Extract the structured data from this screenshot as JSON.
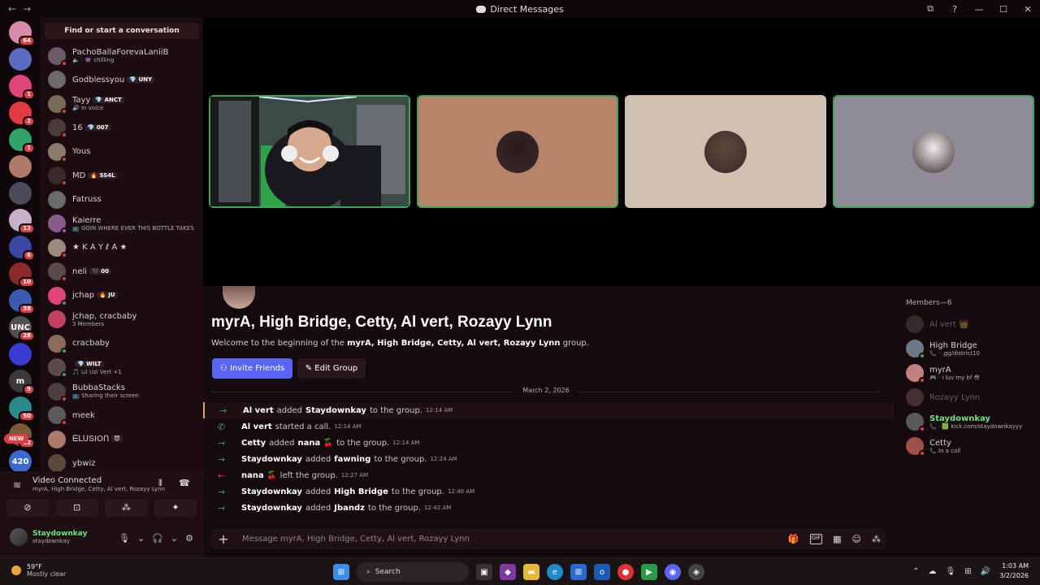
{
  "window": {
    "title": "Direct Messages",
    "back": "←",
    "forward": "→",
    "controls": [
      "⧉",
      "?",
      "—",
      "☐",
      "✕"
    ]
  },
  "guilds": [
    {
      "color": "#d98aa8",
      "badge": "64",
      "label": ""
    },
    {
      "color": "#5b6bc0",
      "badge": "",
      "label": ""
    },
    {
      "color": "#e0457a",
      "badge": "1",
      "label": ""
    },
    {
      "color": "#e23c43",
      "badge": "2",
      "label": ""
    },
    {
      "color": "#2fa36a",
      "badge": "1",
      "label": ""
    },
    {
      "color": "#b07a6a",
      "badge": "",
      "label": ""
    },
    {
      "color": "#4a4a5a",
      "badge": "",
      "label": ""
    },
    {
      "color": "#c8b0c8",
      "badge": "12",
      "label": ""
    },
    {
      "color": "#3b47a0",
      "badge": "6",
      "label": ""
    },
    {
      "color": "#8a2a2a",
      "badge": "10",
      "label": ""
    },
    {
      "color": "#3a5ab0",
      "badge": "38",
      "label": ""
    },
    {
      "color": "#505050",
      "badge": "28",
      "label": "UNC"
    },
    {
      "color": "#3a3ad0",
      "badge": "",
      "label": ""
    },
    {
      "color": "#3a3a3a",
      "badge": "9",
      "label": "m"
    },
    {
      "color": "#2a8a8a",
      "badge": "50",
      "label": ""
    },
    {
      "color": "#7a5a3a",
      "badge": "12",
      "label": ""
    },
    {
      "color": "#3a6ad0",
      "badge": "",
      "label": "420"
    }
  ],
  "guilds_new": "NEW",
  "dm": {
    "search_placeholder": "Find or start a conversation",
    "items": [
      {
        "name": "PachoBallaForevaLaniiB",
        "tag": "",
        "sub": "🔈 · 👾 chilling",
        "avatar": "#6a5a6a",
        "status": "#e23c43"
      },
      {
        "name": "Godblessyou",
        "tag": "💎 UNY",
        "sub": "",
        "avatar": "#6a6a6a",
        "status": ""
      },
      {
        "name": "Tayy",
        "tag": "💎 ANCT",
        "sub": "🔊 In voice",
        "avatar": "#7a6a5a",
        "status": "#e23c43"
      },
      {
        "name": "16",
        "tag": "💎 007",
        "sub": "",
        "avatar": "#4a3a3a",
        "status": "#e23c43"
      },
      {
        "name": "Yous",
        "tag": "",
        "sub": "",
        "avatar": "#8a7a6a",
        "status": "#e23c43"
      },
      {
        "name": "MD",
        "tag": "🔥 SS4L",
        "sub": "",
        "avatar": "#3a2a2a",
        "status": "#e23c43"
      },
      {
        "name": "Fatruss",
        "tag": "",
        "sub": "",
        "avatar": "#6a6a6a",
        "status": ""
      },
      {
        "name": "Kaierre",
        "tag": "",
        "sub": "📺 GOIN WHERE EVER THIS BOTTLE TAKES",
        "avatar": "#8a5a8a",
        "status": "#9b59d0"
      },
      {
        "name": "★ K A Y ℓ A ★",
        "tag": "",
        "sub": "",
        "avatar": "#9a8a7a",
        "status": "#e23c43"
      },
      {
        "name": "neli",
        "tag": "🖤 00",
        "sub": "",
        "avatar": "#5a4a4a",
        "status": "#e23c43"
      },
      {
        "name": "jchap",
        "tag": "🔥 JU",
        "sub": "",
        "avatar": "#e0457a",
        "status": "#3ba55c"
      },
      {
        "name": "jchap, cracbaby",
        "tag": "",
        "sub": "3 Members",
        "avatar": "#c04060",
        "status": ""
      },
      {
        "name": "cracbaby",
        "tag": "",
        "sub": "",
        "avatar": "#8a6a5a",
        "status": "#3ba55c"
      },
      {
        "name": "",
        "tag": "💎 WILT",
        "sub": "🎵 Lil Uzi Vert +1",
        "avatar": "#5a4a4a",
        "status": "#3ba55c"
      },
      {
        "name": "BubbaStacks",
        "tag": "",
        "sub": "📺 Sharing their screen",
        "avatar": "#4a4040",
        "status": "#e23c43"
      },
      {
        "name": "meek",
        "tag": "",
        "sub": "",
        "avatar": "#5a5a5a",
        "status": "#e23c43"
      },
      {
        "name": "ᗴᒪᑌՏIOᑎ",
        "tag": "😈",
        "sub": "",
        "avatar": "#b07a6a",
        "status": ""
      },
      {
        "name": "ybwiz",
        "tag": "",
        "sub": "",
        "avatar": "#5a4a3a",
        "status": ""
      }
    ]
  },
  "voice": {
    "title": "Video Connected",
    "subtitle": "myrA, High Bridge, Cetty, Al vert, Rozayy Lynn",
    "icons": {
      "noise": "⦀",
      "disconnect": "☎"
    },
    "buttons": [
      "⊘",
      "⊡",
      "⁂",
      "✦"
    ]
  },
  "me": {
    "name": "Staydownkay",
    "handle": "staydownkay",
    "controls": [
      "🎙",
      "⌄",
      "🎧",
      "⌄",
      "⚙"
    ]
  },
  "tiles": [
    {
      "bg": "#2d3a34",
      "border": "#3ba55c",
      "pfp": "#e8ddd0",
      "label": "webcam"
    },
    {
      "bg": "#b88469",
      "border": "#3ba55c",
      "pfp": "#2a1a1a",
      "label": ""
    },
    {
      "bg": "#cfc0b0",
      "border": "",
      "pfp": "#5a4a3a",
      "label": ""
    },
    {
      "bg": "#8f8b99",
      "border": "#3ba55c",
      "pfp": "#eeeeee",
      "label": ""
    }
  ],
  "chat": {
    "title": "myrA, High Bridge, Cetty, Al vert, Rozayy Lynn",
    "welcome_prefix": "Welcome to the beginning of the",
    "welcome_group": "myrA, High Bridge, Cetty, Al vert, Rozayy Lynn",
    "welcome_suffix": "group.",
    "invite_label": "Invite Friends",
    "edit_label": "Edit Group",
    "date": "March 2, 2026",
    "messages": [
      {
        "icon": "→",
        "color": "#3ba55c",
        "who": "Al vert",
        "action": "added",
        "target": "Staydownkay",
        "rest": "to the group.",
        "time": "12:14 AM",
        "hl": true
      },
      {
        "icon": "✆",
        "color": "#3ba55c",
        "who": "Al vert",
        "action": "started a call.",
        "target": "",
        "rest": "",
        "time": "12:14 AM",
        "hl": false
      },
      {
        "icon": "→",
        "color": "#3ba55c",
        "who": "Cetty",
        "action": "added",
        "target": "nana 🍒",
        "rest": "to the group.",
        "time": "12:14 AM",
        "hl": false
      },
      {
        "icon": "→",
        "color": "#3ba55c",
        "who": "Staydownkay",
        "action": "added",
        "target": "fawning",
        "rest": "to the group.",
        "time": "12:24 AM",
        "hl": false
      },
      {
        "icon": "←",
        "color": "#e23c43",
        "who": "nana 🍒",
        "action": "left the group.",
        "target": "",
        "rest": "",
        "time": "12:27 AM",
        "hl": false
      },
      {
        "icon": "→",
        "color": "#3ba55c",
        "who": "Staydownkay",
        "action": "added",
        "target": "High Bridge",
        "rest": "to the group.",
        "time": "12:40 AM",
        "hl": false
      },
      {
        "icon": "→",
        "color": "#3ba55c",
        "who": "Staydownkay",
        "action": "added",
        "target": "Jbandz",
        "rest": "to the group.",
        "time": "12:42 AM",
        "hl": false
      }
    ],
    "composer_placeholder": "Message myrA, High Bridge, Cetty, Al vert, Rozayy Lynn",
    "composer_tools": [
      "🎁",
      "GIF",
      "▦",
      "☺",
      "⁂"
    ]
  },
  "members": {
    "header": "Members—6",
    "items": [
      {
        "name": "Al vert 👑",
        "sub": "",
        "avatar": "#6a5a5a",
        "status": "",
        "offline": true,
        "color": "#dcd3d6"
      },
      {
        "name": "High Bridge",
        "sub": "📞 · .gg/district10",
        "avatar": "#6a7a8a",
        "status": "#3ba55c",
        "offline": false,
        "color": "#dcd3d6"
      },
      {
        "name": "myrA",
        "sub": "🎮 · i luv my bf 😳",
        "avatar": "#c08080",
        "status": "#e23c43",
        "offline": false,
        "color": "#dcd3d6"
      },
      {
        "name": "Rozayy Lynn",
        "sub": "",
        "avatar": "#8a6a6a",
        "status": "",
        "offline": true,
        "color": "#dcd3d6"
      },
      {
        "name": "Staydownkay",
        "sub": "📞 · 🟩 kick.com/staydownkayyy",
        "avatar": "#5a5a5a",
        "status": "#e23c43",
        "offline": false,
        "color": "#6ee37a"
      },
      {
        "name": "Cetty",
        "sub": "📞 In a call",
        "avatar": "#a0504a",
        "status": "#e23c43",
        "offline": false,
        "color": "#dcd3d6"
      }
    ]
  },
  "taskbar": {
    "temp": "59°F",
    "weather": "Mostly clear",
    "search": "Search",
    "time": "1:03 AM",
    "date": "3/2/2026",
    "tray": [
      "⌃",
      "☁",
      "🎙",
      "⊞",
      "🔊"
    ]
  }
}
